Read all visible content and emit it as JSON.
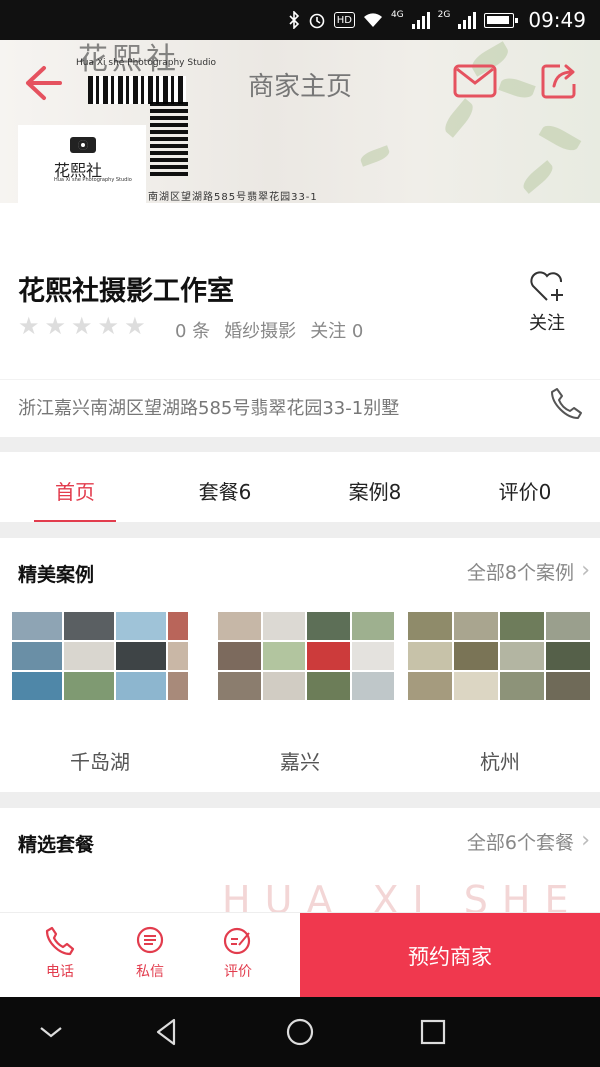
{
  "status_bar": {
    "time": "09:49",
    "hd": "HD",
    "net1": "4G",
    "net2": "2G"
  },
  "banner": {
    "logo_text": "花熙社",
    "logo_sub": "Hua Xi she Photography Studio",
    "card_name": "花熙社",
    "card_sub": "Hua Xi she Photography Studio",
    "address_strip": "南湖区望湖路585号翡翠花园33-1"
  },
  "header": {
    "title": "商家主页"
  },
  "shop": {
    "name": "花熙社摄影工作室",
    "rating_stars": 0,
    "reviews": "0 条",
    "category": "婚纱摄影",
    "followers": "关注 0",
    "follow_label": "关注",
    "address": "浙江嘉兴南湖区望湖路585号翡翠花园33-1别墅"
  },
  "tabs": [
    {
      "label": "首页",
      "active": true
    },
    {
      "label": "套餐6",
      "active": false
    },
    {
      "label": "案例8",
      "active": false
    },
    {
      "label": "评价0",
      "active": false
    }
  ],
  "cases_section": {
    "title": "精美案例",
    "more": "全部8个案例",
    "items": [
      {
        "label": "千岛湖"
      },
      {
        "label": "嘉兴"
      },
      {
        "label": "杭州"
      }
    ]
  },
  "packages_section": {
    "title": "精选套餐",
    "more": "全部6个套餐",
    "watermark": "HUA XI SHE"
  },
  "bottom_bar": {
    "phone": "电话",
    "message": "私信",
    "review": "评价",
    "book": "预约商家"
  },
  "colors": {
    "accent": "#e23c4d",
    "book_bg": "#f0384e"
  }
}
